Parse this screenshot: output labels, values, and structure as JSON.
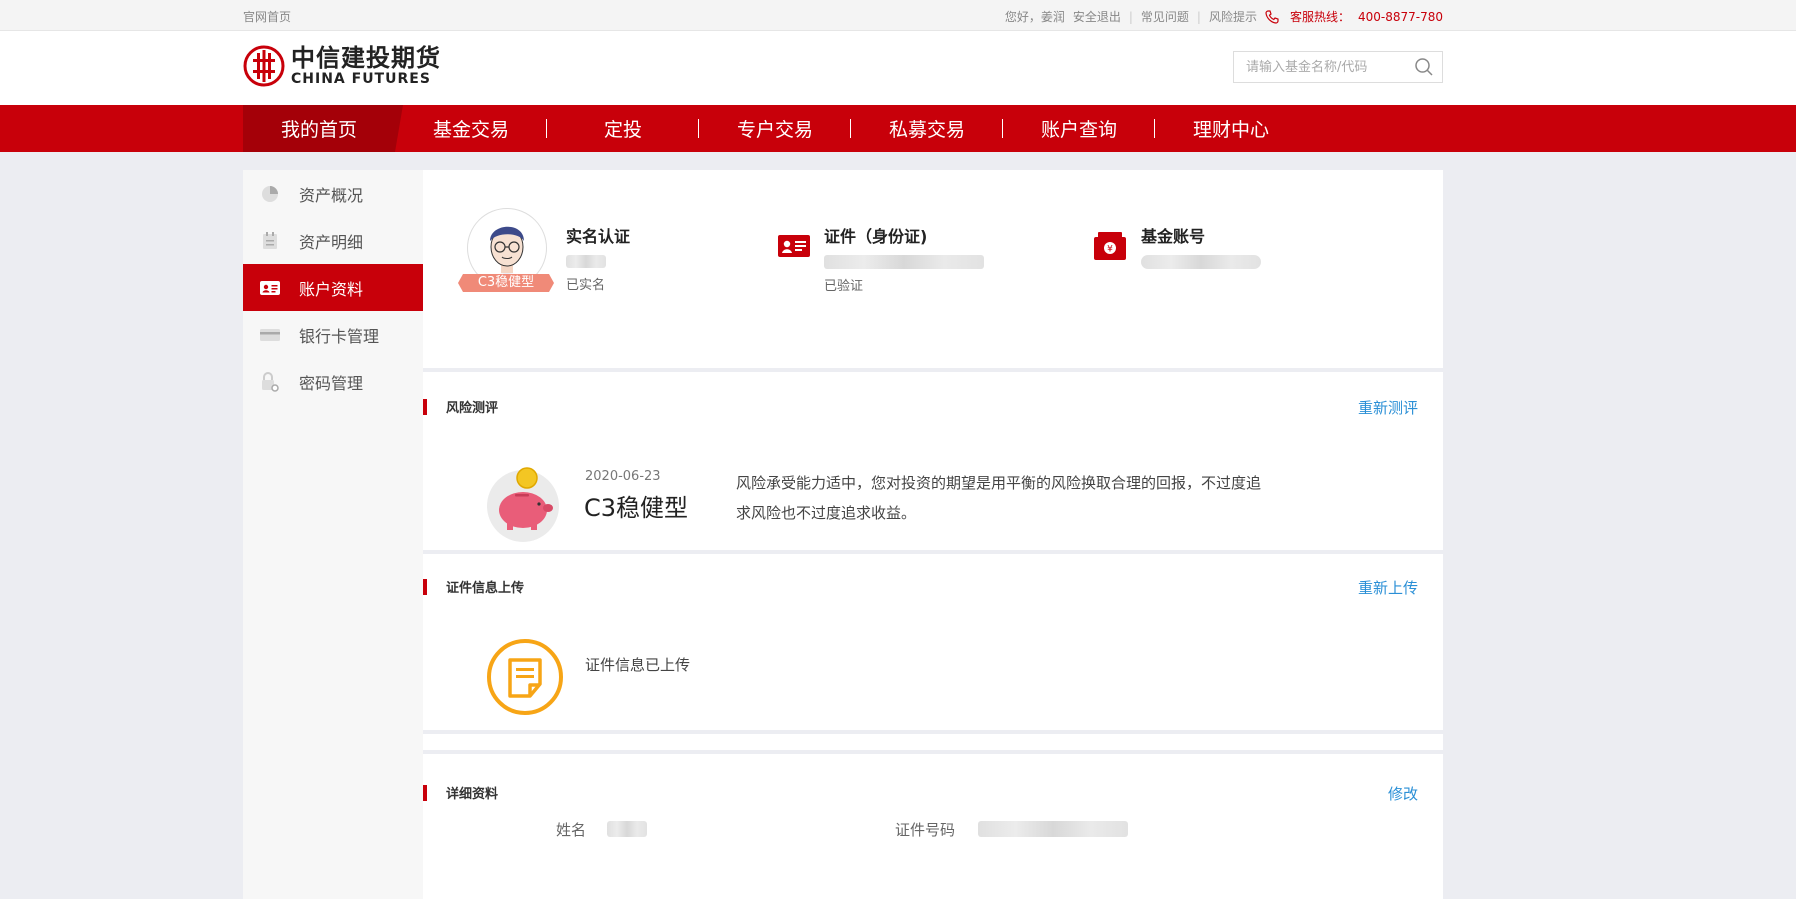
{
  "topbar": {
    "home_link": "官网首页",
    "greeting": "您好，姜润",
    "logout": "安全退出",
    "faq": "常见问题",
    "risk_tips": "风险提示",
    "hotline_label": "客服热线：",
    "hotline_number": "400-8877-780"
  },
  "header": {
    "logo_cn": "中信建投期货",
    "logo_en": "CHINA FUTURES",
    "search_placeholder": "请输入基金名称/代码"
  },
  "nav": {
    "items": [
      "我的首页",
      "基金交易",
      "定投",
      "专户交易",
      "私募交易",
      "账户查询",
      "理财中心"
    ]
  },
  "sidebar": {
    "items": [
      "资产概况",
      "资产明细",
      "账户资料",
      "银行卡管理",
      "密码管理"
    ],
    "active": "账户资料"
  },
  "profile": {
    "risk_badge": "C3稳健型",
    "realname_title": "实名认证",
    "realname_status": "已实名",
    "id_title": "证件（身份证)",
    "id_status": "已验证",
    "fund_account_title": "基金账号"
  },
  "risk": {
    "section_title": "风险测评",
    "action": "重新测评",
    "date": "2020-06-23",
    "level": "C3稳健型",
    "description_line1": "风险承受能力适中，您对投资的期望是用平衡的风险换取合理的回报，不过度追",
    "description_line2": "求风险也不过度追求收益。"
  },
  "upload": {
    "section_title": "证件信息上传",
    "action": "重新上传",
    "status": "证件信息已上传"
  },
  "details": {
    "section_title": "详细资料",
    "action": "修改",
    "name_label": "姓名",
    "id_number_label": "证件号码"
  },
  "colors": {
    "brand_red": "#c8000a",
    "link_blue": "#2a8fd6",
    "upload_orange": "#f7a516"
  }
}
